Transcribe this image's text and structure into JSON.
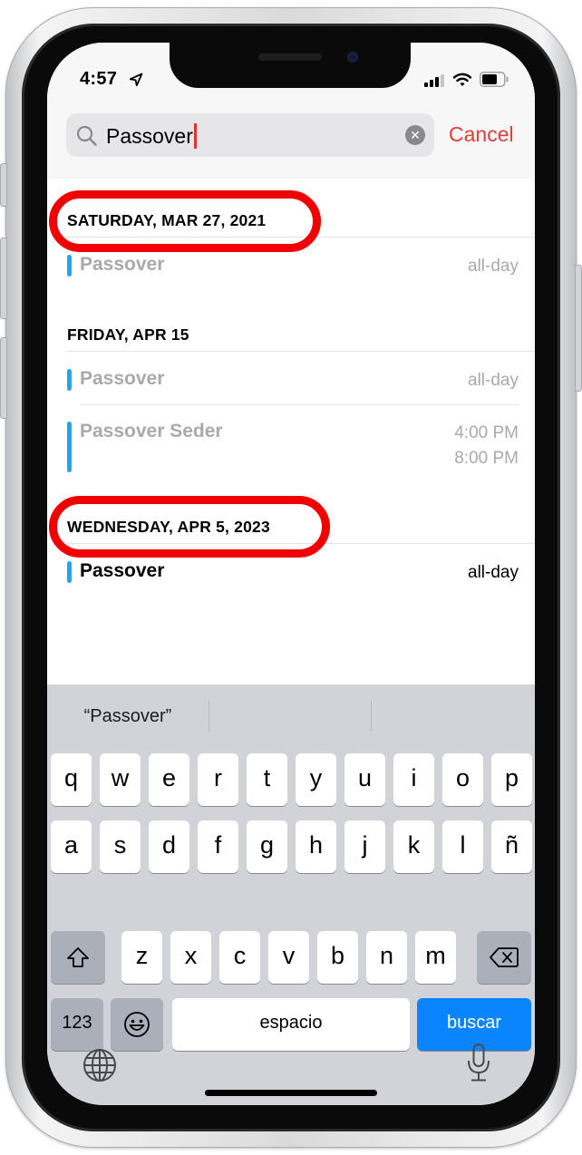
{
  "status_bar": {
    "time": "4:57",
    "location_icon": "location-arrow-icon",
    "signal_icon": "cellular-signal-icon",
    "wifi_icon": "wifi-icon",
    "battery_icon": "battery-icon"
  },
  "search": {
    "value": "Passover",
    "search_icon": "magnifying-glass-icon",
    "clear_icon": "clear-x-icon",
    "clear_glyph": "✕",
    "cancel_label": "Cancel"
  },
  "results": [
    {
      "day": "SATURDAY, MAR 27, 2021",
      "highlighted": true,
      "events": [
        {
          "title": "Passover",
          "time": "all-day",
          "past": true
        }
      ]
    },
    {
      "day": "FRIDAY, APR 15",
      "highlighted": false,
      "events": [
        {
          "title": "Passover",
          "time": "all-day",
          "past": true
        },
        {
          "title": "Passover Seder",
          "start": "4:00 PM",
          "end": "8:00 PM",
          "past": true
        }
      ]
    },
    {
      "day": "WEDNESDAY, APR 5, 2023",
      "highlighted": true,
      "events": [
        {
          "title": "Passover",
          "time": "all-day",
          "past": false
        }
      ]
    }
  ],
  "colors": {
    "accent_cancel": "#d9403a",
    "event_calendar": "#24a5eb",
    "highlight_annotation": "#f00000",
    "keyboard_action": "#0a84ff"
  },
  "keyboard": {
    "suggestions": [
      "“Passover”",
      "",
      ""
    ],
    "row1": [
      "q",
      "w",
      "e",
      "r",
      "t",
      "y",
      "u",
      "i",
      "o",
      "p"
    ],
    "row2": [
      "a",
      "s",
      "d",
      "f",
      "g",
      "h",
      "j",
      "k",
      "l",
      "ñ"
    ],
    "row3": [
      "z",
      "x",
      "c",
      "v",
      "b",
      "n",
      "m"
    ],
    "shift_icon": "shift-arrow-icon",
    "delete_icon": "backspace-icon",
    "numbers_label": "123",
    "emoji_icon": "emoji-smile-icon",
    "space_label": "espacio",
    "action_label": "buscar",
    "globe_icon": "globe-icon",
    "mic_icon": "microphone-icon"
  }
}
